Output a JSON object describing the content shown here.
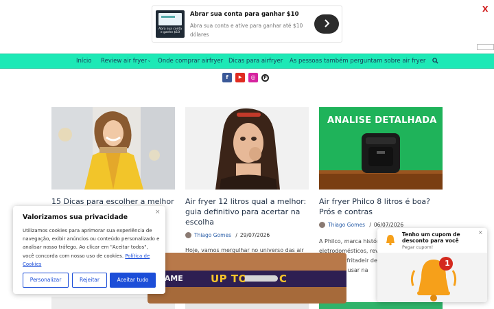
{
  "ad": {
    "thumb_text": "Abra sua conta e ganhe $10",
    "title": "Abrar sua conta para ganhar $10",
    "description": "Abra sua conta e ative para ganhar até $10 dólares",
    "close": "X"
  },
  "nav": {
    "items": [
      "Início",
      "Review air fryer",
      "Onde comprar airfryer",
      "Dicas para airfryer",
      "As pessoas também perguntam sobre air fryer"
    ],
    "dropdown_caret": "›"
  },
  "social": [
    {
      "name": "facebook-icon",
      "glyph": "f",
      "color": "#3b5998"
    },
    {
      "name": "youtube-icon",
      "glyph": "▶",
      "color": "#e02b20"
    },
    {
      "name": "instagram-icon",
      "glyph": "◎",
      "color": "#d6249f"
    },
    {
      "name": "pinterest-icon",
      "glyph": "P",
      "color": "#222222"
    }
  ],
  "cards": [
    {
      "title": "15 Dicas para escolher a melhor",
      "image": "woman-yellow-coat"
    },
    {
      "title": "Air fryer 12 litros qual a melhor: guia definitivo para acertar na escolha",
      "author": "Thiago Gomes",
      "sep": "/",
      "date": "29/07/2026",
      "excerpt": "Hoje, vamos mergulhar no universo das air"
    },
    {
      "title": "Air fryer Philco 8 litros é boa? Prós e contras",
      "author": "Thiago Gomes",
      "sep": "/",
      "date": "06/07/2026",
      "image_text": "ANALISE DETALHADA",
      "excerpt": "A Philco, marca histórica eletrodomésticos, revo com suas fritadeir de fritar sem usar na gordura..."
    }
  ],
  "cookie": {
    "title": "Valorizamos sua privacidade",
    "close": "×",
    "text": "Utilizamos cookies para aprimorar sua experiência de navegação, exibir anúncios ou conteúdo personalizado e analisar nosso tráfego. Ao clicar em \"Aceitar todos\", você concorda com nosso uso de cookies.",
    "link": "Política de Cookies",
    "customize": "Personalizar",
    "reject": "Rejeitar",
    "accept": "Aceitar tudo"
  },
  "game": {
    "left_text": "K.GAME",
    "right_text": "UP TO",
    "tail": "C"
  },
  "coupon": {
    "title": "Tenho um cupom de desconto para você",
    "subtitle": "Pegar cupom!",
    "badge": "1",
    "close": "×"
  },
  "colors": {
    "nav_bg": "#1de9b6",
    "link": "#1c4ed8",
    "bell": "#f6a01a"
  }
}
